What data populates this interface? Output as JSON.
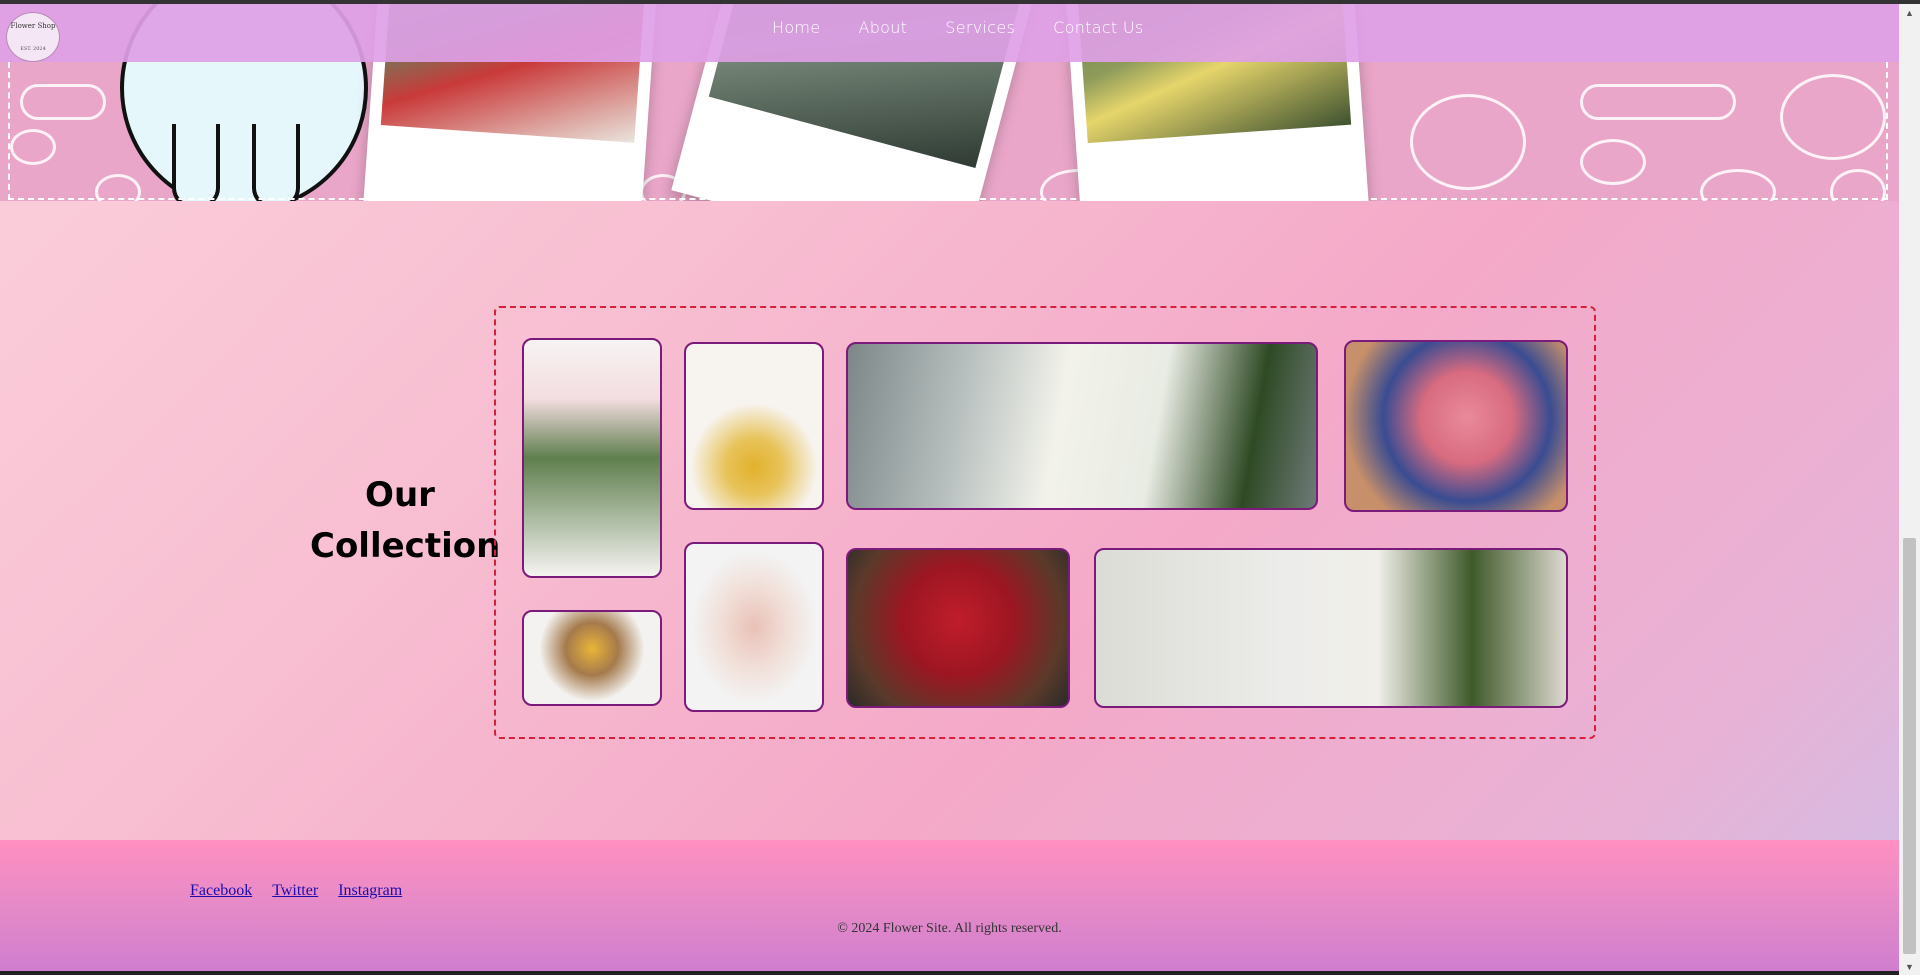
{
  "navbar": {
    "logo": {
      "title": "Flower Shop",
      "subtitle": "EST. 2024"
    },
    "links": [
      "Home",
      "About",
      "Services",
      "Contact Us"
    ]
  },
  "hero": {
    "photos": [
      "shop-photo-1",
      "shop-photo-2",
      "shop-photo-3"
    ]
  },
  "collection": {
    "title": "Our Collection",
    "tiles": [
      {
        "name": "pink-roses-bouquet"
      },
      {
        "name": "yellow-flowers-bag"
      },
      {
        "name": "white-lilies"
      },
      {
        "name": "pink-peonies"
      },
      {
        "name": "sunflower-bouquet-hand"
      },
      {
        "name": "wrapped-dried-bouquet"
      },
      {
        "name": "red-roses-bouquet"
      },
      {
        "name": "white-daisies-thistles"
      }
    ]
  },
  "footer": {
    "social": [
      "Facebook",
      "Twitter",
      "Instagram"
    ],
    "copyright": "© 2024 Flower Site. All rights reserved."
  },
  "colors": {
    "navbar": "#dea0e6",
    "gallery_border": "#d4203a",
    "tile_border": "#7a1a7a",
    "footer_top": "#ff8fc0",
    "footer_bottom": "#cf7dd0"
  }
}
